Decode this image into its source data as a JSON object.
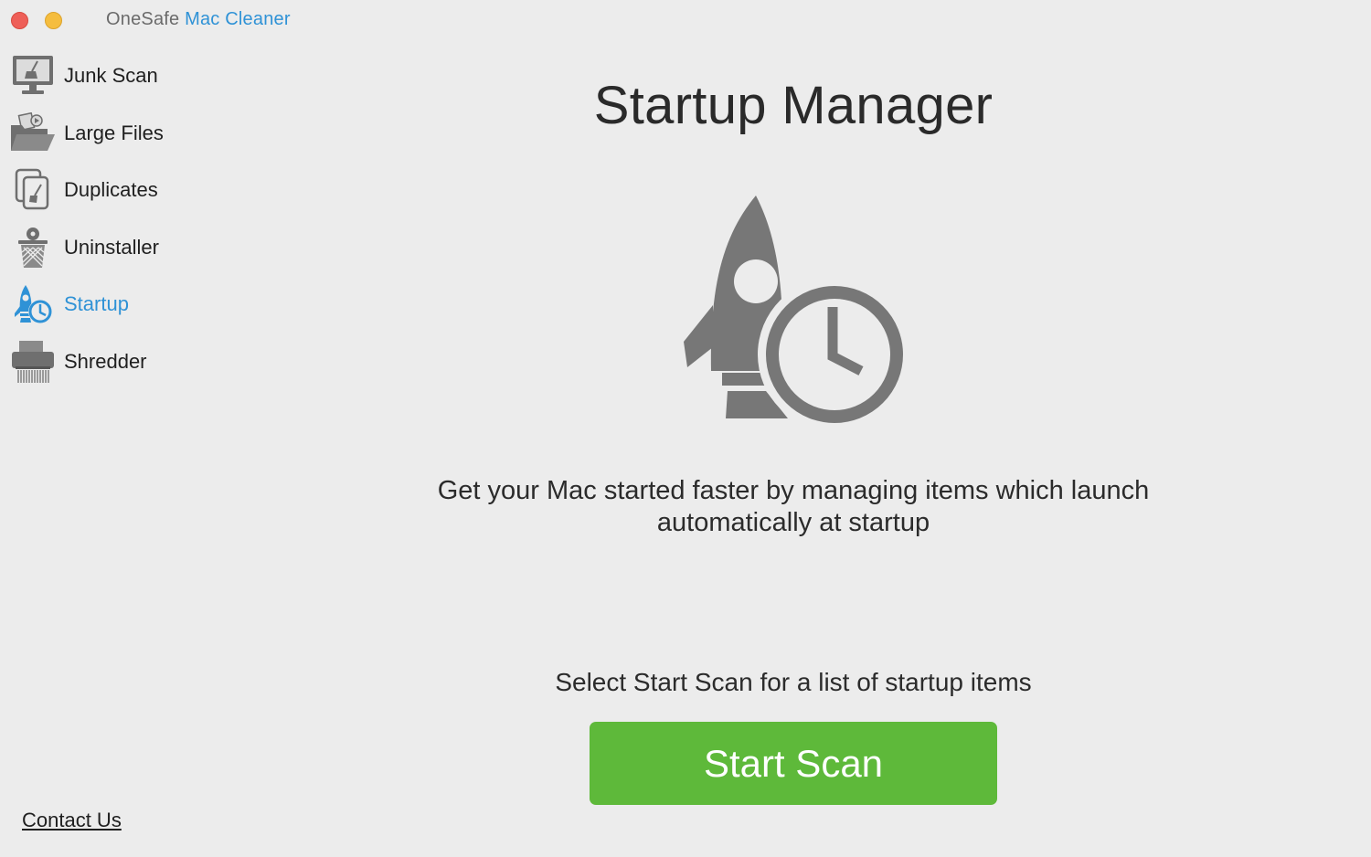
{
  "window": {
    "title_prefix": "OneSafe",
    "title_accent": "Mac Cleaner"
  },
  "sidebar": {
    "items": [
      {
        "label": "Junk Scan",
        "icon": "monitor-broom-icon"
      },
      {
        "label": "Large Files",
        "icon": "open-folder-icon"
      },
      {
        "label": "Duplicates",
        "icon": "duplicate-documents-icon"
      },
      {
        "label": "Uninstaller",
        "icon": "trash-bin-icon"
      },
      {
        "label": "Startup",
        "icon": "rocket-clock-icon",
        "active": true
      },
      {
        "label": "Shredder",
        "icon": "shredder-icon"
      }
    ],
    "contact_label": "Contact Us"
  },
  "main": {
    "title": "Startup Manager",
    "hero_icon": "rocket-clock-icon",
    "description": "Get your Mac started faster by managing items which launch automatically at startup",
    "hint": "Select Start Scan for a list of startup items",
    "scan_button_label": "Start Scan"
  },
  "colors": {
    "accent": "#2f92d6",
    "button_green": "#5eb93a",
    "icon_gray": "#777777",
    "background": "#ececec"
  }
}
